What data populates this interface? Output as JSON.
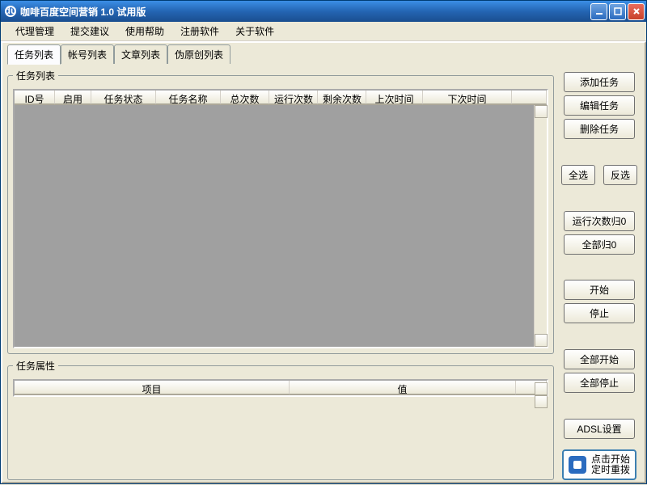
{
  "window": {
    "title": "咖啡百度空间营销 1.0 试用版"
  },
  "menu": [
    "代理管理",
    "提交建议",
    "使用帮助",
    "注册软件",
    "关于软件"
  ],
  "tabs": [
    "任务列表",
    "帐号列表",
    "文章列表",
    "伪原创列表"
  ],
  "active_tab": 0,
  "groups": {
    "tasklist": "任务列表",
    "taskprop": "任务属性"
  },
  "task_columns": [
    "ID号",
    "启用",
    "任务状态",
    "任务名称",
    "总次数",
    "运行次数",
    "剩余次数",
    "上次时间",
    "下次时间"
  ],
  "task_col_widths": [
    50,
    45,
    80,
    80,
    60,
    60,
    60,
    70,
    110
  ],
  "prop_columns": [
    "项目",
    "值"
  ],
  "prop_col_widths": [
    340,
    280
  ],
  "buttons": {
    "add": "添加任务",
    "edit": "编辑任务",
    "del": "删除任务",
    "selall": "全选",
    "selinv": "反选",
    "runreset": "运行次数归0",
    "allreset": "全部归0",
    "start": "开始",
    "stop": "停止",
    "startall": "全部开始",
    "stopall": "全部停止",
    "adsl": "ADSL设置",
    "redial_line1": "点击开始",
    "redial_line2": "定时重拨"
  }
}
